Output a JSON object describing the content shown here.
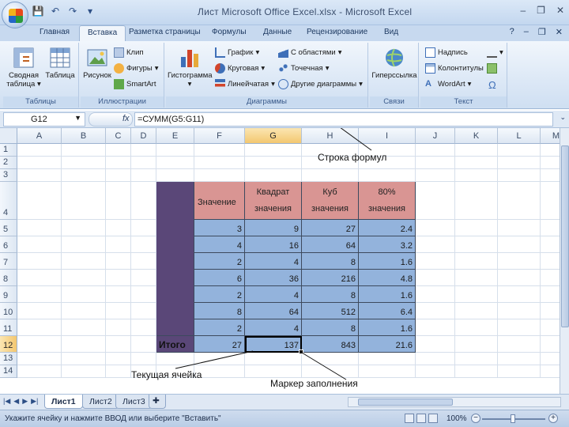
{
  "window": {
    "title": "Лист Microsoft Office Excel.xlsx  -  Microsoft Excel",
    "qat": [
      "save",
      "undo",
      "redo",
      "customize"
    ]
  },
  "ribbon": {
    "tabs": [
      "Главная",
      "Вставка",
      "Разметка страницы",
      "Формулы",
      "Данные",
      "Рецензирование",
      "Вид"
    ],
    "active_tab": "Вставка",
    "groups": {
      "tables": {
        "label": "Таблицы",
        "pivot": "Сводная таблица",
        "table": "Таблица"
      },
      "illustrations": {
        "label": "Иллюстрации",
        "picture": "Рисунок",
        "clip": "Клип",
        "shapes": "Фигуры",
        "smartart": "SmartArt"
      },
      "charts": {
        "label": "Диаграммы",
        "histogram": "Гистограмма",
        "line": "График",
        "pie": "Круговая",
        "bar": "Линейчатая",
        "area": "С областями",
        "scatter": "Точечная",
        "other": "Другие диаграммы"
      },
      "links": {
        "label": "Связи",
        "hyperlink": "Гиперссылка"
      },
      "text": {
        "label": "Текст",
        "textbox": "Надпись",
        "headerfooter": "Колонтитулы",
        "wordart": "WordArt",
        "symbol": "Ω"
      }
    }
  },
  "formula_bar": {
    "name_box": "G12",
    "fx": "fx",
    "formula": "=СУММ(G5:G11)"
  },
  "grid": {
    "columns": [
      "A",
      "B",
      "C",
      "D",
      "E",
      "F",
      "G",
      "H",
      "I",
      "J",
      "K",
      "L",
      "M"
    ],
    "rows": [
      "1",
      "2",
      "3",
      "4",
      "5",
      "6",
      "7",
      "8",
      "9",
      "10",
      "11",
      "12",
      "13",
      "14"
    ],
    "selected_col": "G",
    "selected_row": "12"
  },
  "table": {
    "headers": {
      "value": "Значение",
      "square_1": "Квадрат",
      "square_2": "значения",
      "cube_1": "Куб",
      "cube_2": "значения",
      "pct_1": "80%",
      "pct_2": "значения"
    },
    "rows": [
      [
        "3",
        "9",
        "27",
        "2.4"
      ],
      [
        "4",
        "16",
        "64",
        "3.2"
      ],
      [
        "2",
        "4",
        "8",
        "1.6"
      ],
      [
        "6",
        "36",
        "216",
        "4.8"
      ],
      [
        "2",
        "4",
        "8",
        "1.6"
      ],
      [
        "8",
        "64",
        "512",
        "6.4"
      ],
      [
        "2",
        "4",
        "8",
        "1.6"
      ]
    ],
    "total_label": "Итого",
    "totals": [
      "27",
      "137",
      "843",
      "21.6"
    ],
    "colors": {
      "header": "#d99593",
      "body": "#93b3dc",
      "side": "#5a4778"
    }
  },
  "annotations": {
    "formula_row": "Строка формул",
    "current_cell": "Текущая ячейка",
    "fill_handle": "Маркер заполнения"
  },
  "sheets": {
    "tabs": [
      "Лист1",
      "Лист2",
      "Лист3"
    ],
    "active": "Лист1"
  },
  "status": {
    "text": "Укажите ячейку и нажмите ВВОД или выберите \"Вставить\"",
    "zoom": "100%"
  }
}
